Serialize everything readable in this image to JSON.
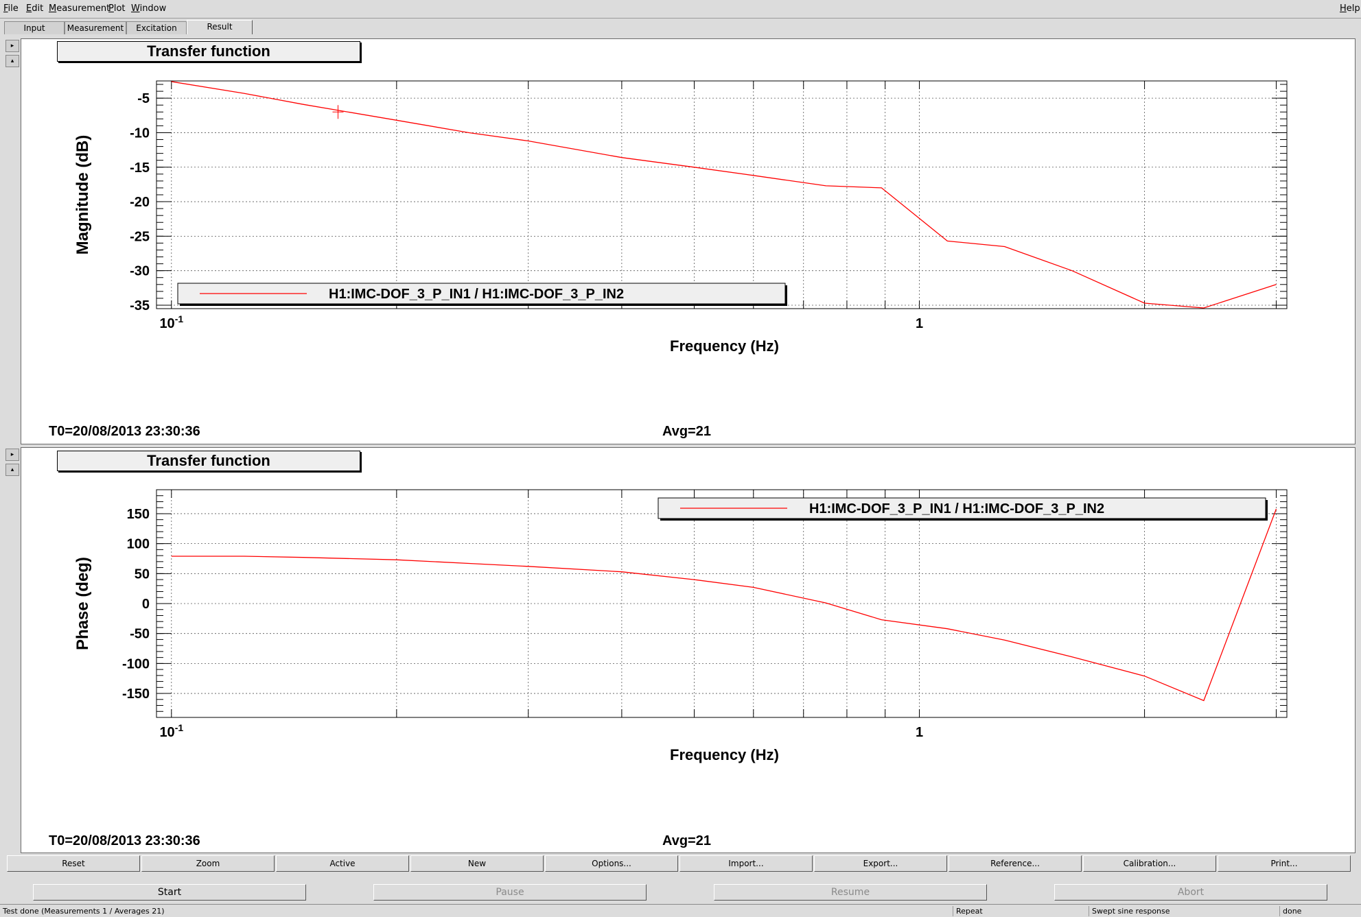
{
  "menu": {
    "file": {
      "u": "F",
      "rest": "ile"
    },
    "edit": {
      "u": "E",
      "rest": "dit"
    },
    "measurement": {
      "u": "M",
      "rest": "easurement"
    },
    "plot": {
      "u": "P",
      "rest": "lot"
    },
    "window": {
      "u": "W",
      "rest": "indow"
    },
    "help": {
      "u": "H",
      "rest": "elp"
    }
  },
  "tabs": [
    "Input",
    "Measurement",
    "Excitation",
    "Result"
  ],
  "active_tab": "Result",
  "side_buttons": {
    "right": "▸",
    "up": "▴"
  },
  "plots": [
    {
      "title": "Transfer function",
      "t0": "T0=20/08/2013 23:30:36",
      "avg": "Avg=21",
      "legend": "H1:IMC-DOF_3_P_IN1 / H1:IMC-DOF_3_P_IN2",
      "legend_position": "bottom-left"
    },
    {
      "title": "Transfer function",
      "t0": "T0=20/08/2013 23:30:36",
      "avg": "Avg=21",
      "legend": "H1:IMC-DOF_3_P_IN1 / H1:IMC-DOF_3_P_IN2",
      "legend_position": "top-right"
    }
  ],
  "chart_data": [
    {
      "type": "line",
      "title": "",
      "xlabel": "Frequency (Hz)",
      "ylabel": "Magnitude (dB)",
      "xscale": "log",
      "xlim": [
        0.0955,
        3.1
      ],
      "ylim": [
        -35.5,
        -2.5
      ],
      "x_tick_labels": [
        {
          "value": 0.1,
          "base": "10",
          "exp": "-1"
        },
        {
          "value": 1,
          "base": "1",
          "exp": ""
        }
      ],
      "y_ticks": [
        -5,
        -10,
        -15,
        -20,
        -25,
        -30,
        -35
      ],
      "grid": true,
      "color": "#ff0000",
      "cursor": [
        0.167,
        -7.0
      ],
      "series": [
        {
          "name": "H1:IMC-DOF_3_P_IN1 / H1:IMC-DOF_3_P_IN2",
          "x": [
            0.1,
            0.125,
            0.15,
            0.2,
            0.25,
            0.3,
            0.4,
            0.5,
            0.6,
            0.75,
            0.89,
            1.09,
            1.3,
            1.6,
            2.0,
            2.4,
            3.0
          ],
          "y": [
            -2.6,
            -4.3,
            -5.9,
            -8.2,
            -10.0,
            -11.2,
            -13.6,
            -15.0,
            -16.2,
            -17.7,
            -18.0,
            -25.7,
            -26.5,
            -30.0,
            -34.7,
            -35.4,
            -32.0
          ]
        }
      ]
    },
    {
      "type": "line",
      "title": "",
      "xlabel": "Frequency (Hz)",
      "ylabel": "Phase (deg)",
      "xscale": "log",
      "xlim": [
        0.0955,
        3.1
      ],
      "ylim": [
        -190,
        190
      ],
      "x_tick_labels": [
        {
          "value": 0.1,
          "base": "10",
          "exp": "-1"
        },
        {
          "value": 1,
          "base": "1",
          "exp": ""
        }
      ],
      "y_ticks": [
        150,
        100,
        50,
        0,
        -50,
        -100,
        -150
      ],
      "grid": true,
      "color": "#ff0000",
      "series": [
        {
          "name": "H1:IMC-DOF_3_P_IN1 / H1:IMC-DOF_3_P_IN2",
          "x": [
            0.1,
            0.125,
            0.15,
            0.2,
            0.25,
            0.3,
            0.4,
            0.5,
            0.6,
            0.75,
            0.89,
            1.09,
            1.3,
            1.6,
            2.0,
            2.4,
            3.0
          ],
          "y": [
            79,
            79,
            77,
            73,
            67,
            62,
            53,
            40,
            27,
            1,
            -27,
            -42,
            -61,
            -89,
            -121,
            -162,
            158
          ]
        }
      ]
    }
  ],
  "buttons": [
    "Reset",
    "Zoom",
    "Active",
    "New",
    "Options...",
    "Import...",
    "Export...",
    "Reference...",
    "Calibration...",
    "Print..."
  ],
  "run_buttons": {
    "start": "Start",
    "pause": "Pause",
    "resume": "Resume",
    "abort": "Abort"
  },
  "status": {
    "message": "Test done (Measurements 1 / Averages 21)",
    "repeat": "Repeat",
    "type": "Swept sine response",
    "state": "done"
  }
}
